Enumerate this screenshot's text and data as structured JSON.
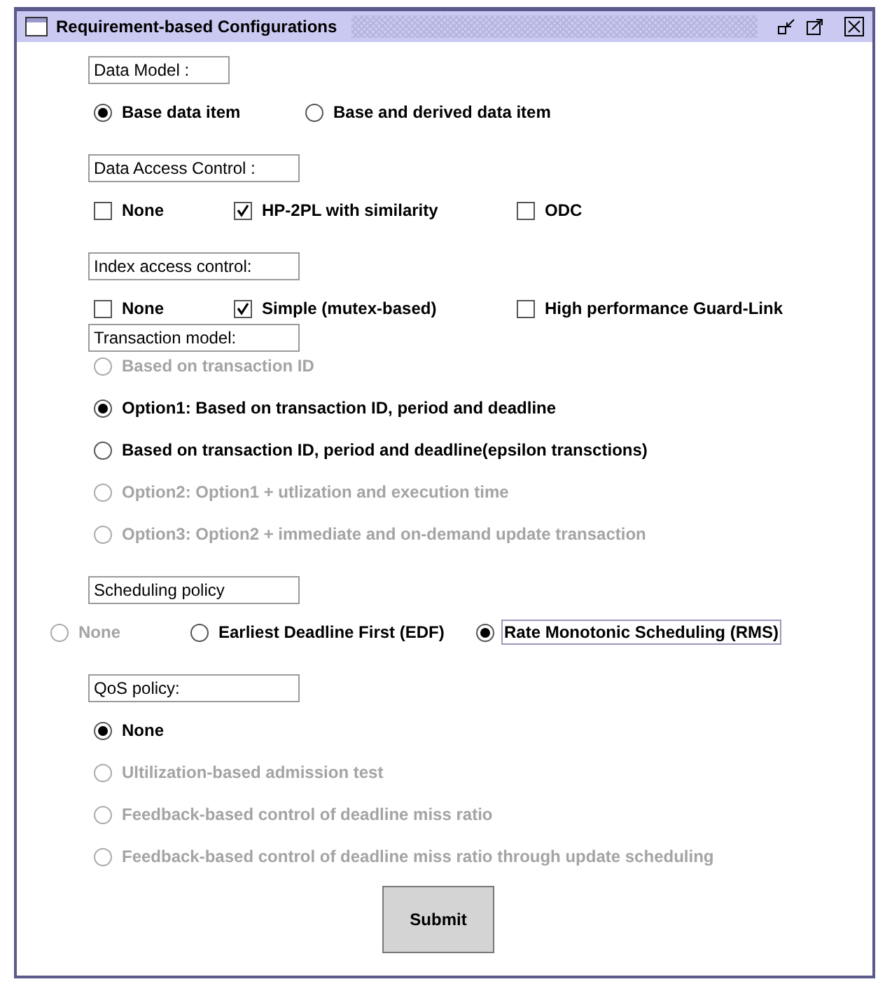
{
  "window": {
    "title": "Requirement-based Configurations"
  },
  "sections": [
    {
      "label": "Data Model :",
      "kind": "radio-row",
      "options": [
        {
          "label": "Base data item",
          "selected": true,
          "disabled": false
        },
        {
          "label": "Base and derived data item",
          "selected": false,
          "disabled": false
        }
      ]
    },
    {
      "label": "Data Access Control :",
      "kind": "checkbox-row",
      "options": [
        {
          "label": "None",
          "checked": false,
          "disabled": false
        },
        {
          "label": "HP-2PL with similarity",
          "checked": true,
          "disabled": false
        },
        {
          "label": "ODC",
          "checked": false,
          "disabled": false
        }
      ]
    },
    {
      "label": "Index access control:",
      "kind": "checkbox-row",
      "options": [
        {
          "label": "None",
          "checked": false,
          "disabled": false
        },
        {
          "label": "Simple (mutex-based)",
          "checked": true,
          "disabled": false
        },
        {
          "label": "High performance Guard-Link",
          "checked": false,
          "disabled": false
        }
      ]
    },
    {
      "label": "Transaction model:",
      "kind": "radio-column",
      "options": [
        {
          "label": "Based on transaction ID",
          "selected": false,
          "disabled": true
        },
        {
          "label": "Option1: Based on transaction ID, period and deadline",
          "selected": true,
          "disabled": false
        },
        {
          "label": "Based on transaction ID, period and deadline(epsilon transctions)",
          "selected": false,
          "disabled": false
        },
        {
          "label": "Option2: Option1 + utlization and execution time",
          "selected": false,
          "disabled": true
        },
        {
          "label": "Option3: Option2 + immediate and on-demand update transaction",
          "selected": false,
          "disabled": true
        }
      ]
    },
    {
      "label": "Scheduling policy",
      "kind": "radio-row",
      "options": [
        {
          "label": "None",
          "selected": false,
          "disabled": true,
          "focused": false
        },
        {
          "label": "Earliest Deadline First (EDF)",
          "selected": false,
          "disabled": false,
          "focused": false
        },
        {
          "label": "Rate Monotonic Scheduling (RMS)",
          "selected": true,
          "disabled": false,
          "focused": true
        }
      ]
    },
    {
      "label": "QoS policy:",
      "kind": "radio-column",
      "options": [
        {
          "label": "None",
          "selected": true,
          "disabled": false
        },
        {
          "label": "Ultilization-based admission test",
          "selected": false,
          "disabled": true
        },
        {
          "label": "Feedback-based control of deadline miss ratio",
          "selected": false,
          "disabled": true
        },
        {
          "label": "Feedback-based control of deadline miss ratio through update scheduling",
          "selected": false,
          "disabled": true
        }
      ]
    }
  ],
  "submit": {
    "label": "Submit"
  }
}
